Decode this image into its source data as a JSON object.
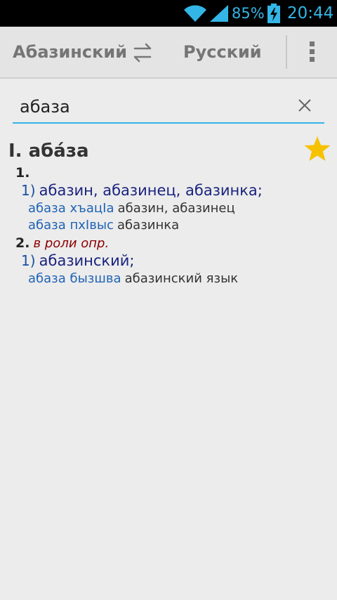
{
  "status_bar": {
    "battery_percent": "85%",
    "time": "20:44",
    "icons": [
      "wifi-icon",
      "signal-icon",
      "battery-charging-icon"
    ],
    "color": "#33b5e5"
  },
  "action_bar": {
    "source_language": "Абазинский",
    "target_language": "Русский",
    "icons": [
      "swap-icon",
      "overflow-menu-icon"
    ]
  },
  "search": {
    "value": "абаза",
    "icons": [
      "clear-icon"
    ],
    "accent_color": "#33b5e5"
  },
  "entry": {
    "headword": "I. аба́за",
    "favorite_icon": "star-icon",
    "favorite_color": "#f6c200",
    "senses": [
      {
        "number": "1.",
        "label": "",
        "subsenses": [
          {
            "number": "1)",
            "translation": "абазин, абазинец, абазинка;",
            "examples": [
              {
                "source": "абаза хъацIа",
                "translation": "абазин, абазинец"
              },
              {
                "source": "абаза пхIвыс",
                "translation": "абазинка"
              }
            ]
          }
        ]
      },
      {
        "number": "2.",
        "label": "в роли опр.",
        "subsenses": [
          {
            "number": "1)",
            "translation": "абазинский;",
            "examples": [
              {
                "source": "абаза бызшва",
                "translation": "абазинский язык"
              }
            ]
          }
        ]
      }
    ]
  }
}
